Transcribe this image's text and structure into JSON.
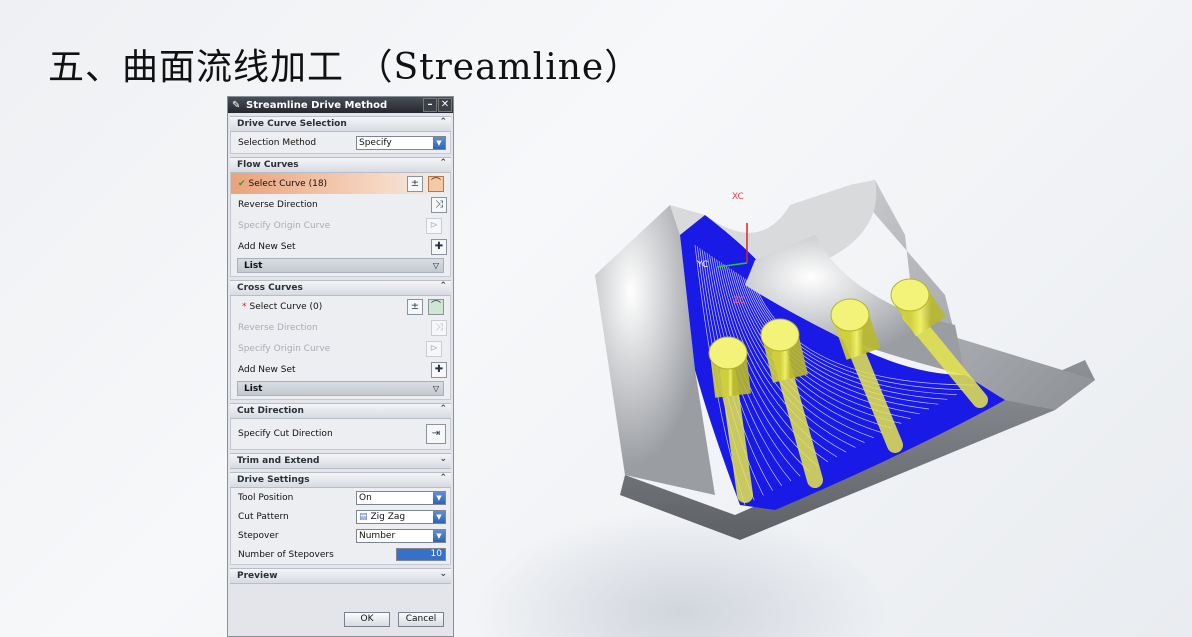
{
  "slide": {
    "title": "五、曲面流线加工 （Streamline）"
  },
  "dialog": {
    "title": "Streamline Drive Method",
    "drive_curve_selection": {
      "header": "Drive Curve Selection",
      "selection_method_label": "Selection Method",
      "selection_method_value": "Specify"
    },
    "flow_curves": {
      "header": "Flow Curves",
      "select_curve": "Select Curve (18)",
      "reverse_direction": "Reverse Direction",
      "specify_origin_curve": "Specify Origin Curve",
      "add_new_set": "Add New Set",
      "list": "List"
    },
    "cross_curves": {
      "header": "Cross Curves",
      "select_curve": "Select Curve (0)",
      "reverse_direction": "Reverse Direction",
      "specify_origin_curve": "Specify Origin Curve",
      "add_new_set": "Add New Set",
      "list": "List"
    },
    "cut_direction": {
      "header": "Cut Direction",
      "specify_cut_direction": "Specify Cut Direction"
    },
    "trim_and_extend": {
      "header": "Trim and Extend"
    },
    "drive_settings": {
      "header": "Drive Settings",
      "tool_position_label": "Tool Position",
      "tool_position_value": "On",
      "cut_pattern_label": "Cut Pattern",
      "cut_pattern_value": "Zig Zag",
      "stepover_label": "Stepover",
      "stepover_value": "Number",
      "number_of_stepovers_label": "Number of Stepovers",
      "number_of_stepovers_value": "10"
    },
    "preview": {
      "header": "Preview"
    },
    "ok_label": "OK",
    "cancel_label": "Cancel"
  },
  "viewport": {
    "axis_xc": "XC",
    "axis_yc": "YC",
    "axis_zc": "ZC",
    "toolpath_color": "#1a1ae6",
    "tool_color": "#e6e64d"
  }
}
